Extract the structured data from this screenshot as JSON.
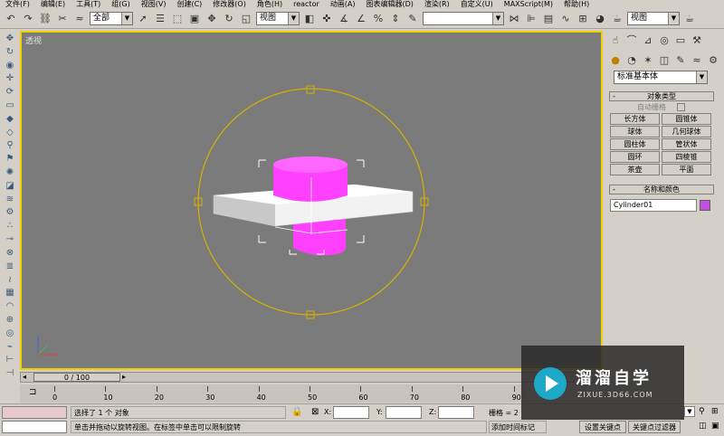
{
  "menubar": {
    "items": [
      "文件(F)",
      "编辑(E)",
      "工具(T)",
      "组(G)",
      "视图(V)",
      "创建(C)",
      "修改器(O)",
      "角色(H)",
      "reactor",
      "动画(A)",
      "图表编辑器(D)",
      "渲染(R)",
      "自定义(U)",
      "MAXScript(M)",
      "帮助(H)"
    ]
  },
  "toolbar": {
    "selection_filter": "全部",
    "ref_coord": "视图",
    "named_selection": "",
    "view_dropdown": "视图"
  },
  "viewport": {
    "label": "透视",
    "bg_color": "#7b7b7b",
    "border_color": "#f0d000",
    "gizmo_color": "#d4b000",
    "object_color": "#ff40ff",
    "box_color": "#ffffff"
  },
  "command_panel": {
    "category_dropdown": "标准基本体",
    "object_type_title": "对象类型",
    "autogrid_label": "自动栅格",
    "buttons": [
      [
        "长方体",
        "圆锥体"
      ],
      [
        "球体",
        "几何球体"
      ],
      [
        "圆柱体",
        "管状体"
      ],
      [
        "圆环",
        "四棱锥"
      ],
      [
        "茶壶",
        "平面"
      ]
    ],
    "name_color_title": "名称和颜色",
    "object_name": "Cylinder01",
    "object_swatch_color": "#c050e0"
  },
  "time": {
    "slider_label": "0 / 100",
    "ticks": [
      "0",
      "10",
      "20",
      "30",
      "40",
      "50",
      "60",
      "70",
      "80",
      "90"
    ]
  },
  "status": {
    "selection_text": "选择了 1 个 对象",
    "prompt_text": "单击并拖动以旋转视图。在标签中单击可以限制旋转",
    "x_label": "X:",
    "y_label": "Y:",
    "z_label": "Z:",
    "grid_label": "栅格 = 2",
    "add_time_tag": "添加时间标记",
    "set_key": "设置关键点",
    "key_filters": "关键点过滤器"
  },
  "watermark": {
    "brand": "溜溜自学",
    "url": "ZIXUE.3D66.COM"
  }
}
